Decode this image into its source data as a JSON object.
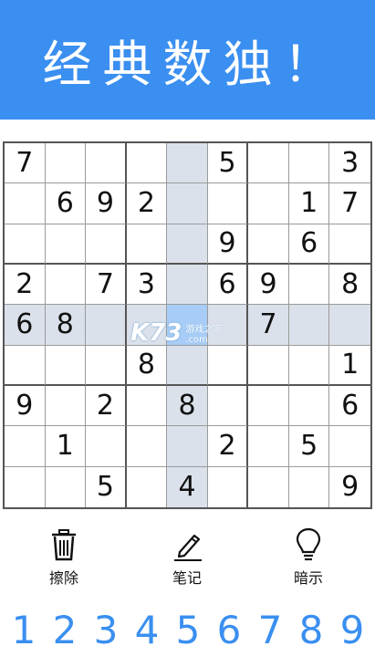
{
  "header": {
    "title": "经典数独！"
  },
  "board": {
    "rows": [
      [
        "7",
        "",
        "",
        "",
        "",
        "5",
        "",
        "",
        "3"
      ],
      [
        "",
        "6",
        "9",
        "2",
        "",
        "",
        "",
        "1",
        "7"
      ],
      [
        "",
        "",
        "",
        "",
        "",
        "9",
        "",
        "6",
        ""
      ],
      [
        "2",
        "",
        "7",
        "3",
        "",
        "6",
        "9",
        "",
        "8"
      ],
      [
        "6",
        "8",
        "",
        "",
        "",
        "",
        "7",
        "",
        ""
      ],
      [
        "",
        "",
        "",
        "8",
        "",
        "",
        "",
        "",
        "1"
      ],
      [
        "9",
        "",
        "2",
        "",
        "8",
        "",
        "",
        "",
        "6"
      ],
      [
        "",
        "1",
        "",
        "",
        "",
        "2",
        "",
        "5",
        ""
      ],
      [
        "",
        "",
        "5",
        "",
        "4",
        "",
        "",
        "",
        "9"
      ]
    ],
    "selected": {
      "row": 5,
      "col": 5
    },
    "highlight_color": "#dbe1ea",
    "selected_color": "#a7cdf6"
  },
  "watermark": {
    "logo": "K73",
    "cn": "游戏之家",
    "url": ".com"
  },
  "tools": [
    {
      "id": "erase",
      "label": "擦除",
      "icon": "trash-icon"
    },
    {
      "id": "notes",
      "label": "笔记",
      "icon": "pencil-icon"
    },
    {
      "id": "hint",
      "label": "暗示",
      "icon": "lightbulb-icon"
    }
  ],
  "numpad": [
    "1",
    "2",
    "3",
    "4",
    "5",
    "6",
    "7",
    "8",
    "9"
  ],
  "colors": {
    "banner": "#3a8ff0",
    "digit": "#3a8ff0"
  }
}
